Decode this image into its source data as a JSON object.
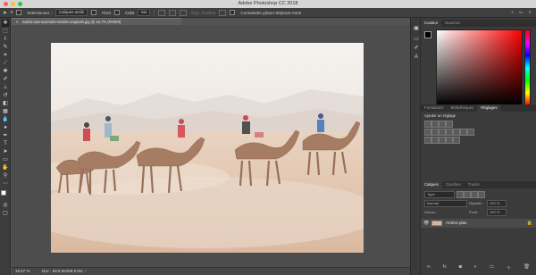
{
  "window": {
    "title": "Adobe Photoshop CC 2018",
    "controls": {
      "close": "#ff5f57",
      "minimize": "#febc2e",
      "zoom": "#28c840"
    }
  },
  "options_bar": {
    "auto_select_label": "Sélectionner :",
    "auto_select_value": "Calques actifs",
    "feather_label": "Pixel",
    "size_label": "Calst",
    "size_value": "Mo",
    "align_label": "Align. bordure",
    "transform_label": "Contraindre glisser-déplacer tracé"
  },
  "toolbar": {
    "tools": [
      "move",
      "marquee",
      "lasso",
      "quick-select",
      "crop",
      "eyedropper",
      "heal",
      "brush",
      "stamp",
      "history-brush",
      "eraser",
      "gradient",
      "blur",
      "dodge",
      "pen",
      "type",
      "path-select",
      "shape",
      "hand",
      "zoom",
      "more"
    ]
  },
  "document": {
    "tab_label": "maldo-tamnoutchafe-81838-unsplash.jpg @ 16,7% (RVB/8)",
    "zoom": "16,67 %",
    "doc_info": "Doc : 68,9 Mo/68,9 Mo"
  },
  "panels": {
    "color_tabs": [
      "Couleur",
      "Nuancier"
    ],
    "color_active": "Couleur",
    "adjust_tabs": [
      "Formations",
      "Bibliothèques",
      "Réglages"
    ],
    "adjust_active": "Réglages",
    "adjust_title": "Ajouter un réglage",
    "layers_tabs": [
      "Calques",
      "Couches",
      "Tracés"
    ],
    "layers_active": "Calques",
    "search_placeholder": "Type",
    "blend_mode": "Normal",
    "opacity_label": "Opacité :",
    "opacity_value": "100 %",
    "lock_label": "Verrou :",
    "fill_label": "Fond :",
    "fill_value": "100 %",
    "layer_name": "Arrière-plan"
  },
  "colors": {
    "accent": "#1473e6",
    "ui_dark": "#3b3b3b",
    "foreground": "#ffffff",
    "background": "#000000"
  }
}
